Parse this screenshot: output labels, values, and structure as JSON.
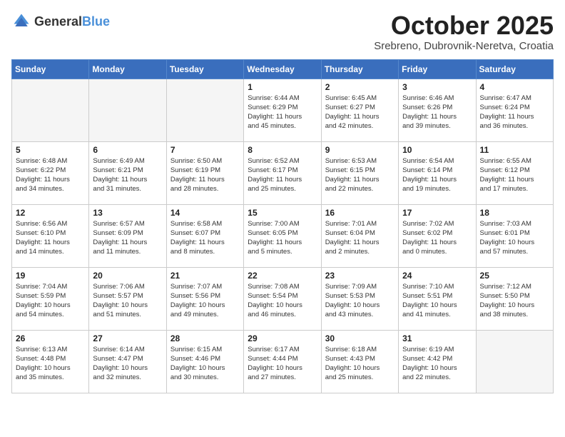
{
  "header": {
    "logo_general": "General",
    "logo_blue": "Blue",
    "month_title": "October 2025",
    "location": "Srebreno, Dubrovnik-Neretva, Croatia"
  },
  "days_of_week": [
    "Sunday",
    "Monday",
    "Tuesday",
    "Wednesday",
    "Thursday",
    "Friday",
    "Saturday"
  ],
  "weeks": [
    [
      {
        "day": "",
        "info": ""
      },
      {
        "day": "",
        "info": ""
      },
      {
        "day": "",
        "info": ""
      },
      {
        "day": "1",
        "info": "Sunrise: 6:44 AM\nSunset: 6:29 PM\nDaylight: 11 hours\nand 45 minutes."
      },
      {
        "day": "2",
        "info": "Sunrise: 6:45 AM\nSunset: 6:27 PM\nDaylight: 11 hours\nand 42 minutes."
      },
      {
        "day": "3",
        "info": "Sunrise: 6:46 AM\nSunset: 6:26 PM\nDaylight: 11 hours\nand 39 minutes."
      },
      {
        "day": "4",
        "info": "Sunrise: 6:47 AM\nSunset: 6:24 PM\nDaylight: 11 hours\nand 36 minutes."
      }
    ],
    [
      {
        "day": "5",
        "info": "Sunrise: 6:48 AM\nSunset: 6:22 PM\nDaylight: 11 hours\nand 34 minutes."
      },
      {
        "day": "6",
        "info": "Sunrise: 6:49 AM\nSunset: 6:21 PM\nDaylight: 11 hours\nand 31 minutes."
      },
      {
        "day": "7",
        "info": "Sunrise: 6:50 AM\nSunset: 6:19 PM\nDaylight: 11 hours\nand 28 minutes."
      },
      {
        "day": "8",
        "info": "Sunrise: 6:52 AM\nSunset: 6:17 PM\nDaylight: 11 hours\nand 25 minutes."
      },
      {
        "day": "9",
        "info": "Sunrise: 6:53 AM\nSunset: 6:15 PM\nDaylight: 11 hours\nand 22 minutes."
      },
      {
        "day": "10",
        "info": "Sunrise: 6:54 AM\nSunset: 6:14 PM\nDaylight: 11 hours\nand 19 minutes."
      },
      {
        "day": "11",
        "info": "Sunrise: 6:55 AM\nSunset: 6:12 PM\nDaylight: 11 hours\nand 17 minutes."
      }
    ],
    [
      {
        "day": "12",
        "info": "Sunrise: 6:56 AM\nSunset: 6:10 PM\nDaylight: 11 hours\nand 14 minutes."
      },
      {
        "day": "13",
        "info": "Sunrise: 6:57 AM\nSunset: 6:09 PM\nDaylight: 11 hours\nand 11 minutes."
      },
      {
        "day": "14",
        "info": "Sunrise: 6:58 AM\nSunset: 6:07 PM\nDaylight: 11 hours\nand 8 minutes."
      },
      {
        "day": "15",
        "info": "Sunrise: 7:00 AM\nSunset: 6:05 PM\nDaylight: 11 hours\nand 5 minutes."
      },
      {
        "day": "16",
        "info": "Sunrise: 7:01 AM\nSunset: 6:04 PM\nDaylight: 11 hours\nand 2 minutes."
      },
      {
        "day": "17",
        "info": "Sunrise: 7:02 AM\nSunset: 6:02 PM\nDaylight: 11 hours\nand 0 minutes."
      },
      {
        "day": "18",
        "info": "Sunrise: 7:03 AM\nSunset: 6:01 PM\nDaylight: 10 hours\nand 57 minutes."
      }
    ],
    [
      {
        "day": "19",
        "info": "Sunrise: 7:04 AM\nSunset: 5:59 PM\nDaylight: 10 hours\nand 54 minutes."
      },
      {
        "day": "20",
        "info": "Sunrise: 7:06 AM\nSunset: 5:57 PM\nDaylight: 10 hours\nand 51 minutes."
      },
      {
        "day": "21",
        "info": "Sunrise: 7:07 AM\nSunset: 5:56 PM\nDaylight: 10 hours\nand 49 minutes."
      },
      {
        "day": "22",
        "info": "Sunrise: 7:08 AM\nSunset: 5:54 PM\nDaylight: 10 hours\nand 46 minutes."
      },
      {
        "day": "23",
        "info": "Sunrise: 7:09 AM\nSunset: 5:53 PM\nDaylight: 10 hours\nand 43 minutes."
      },
      {
        "day": "24",
        "info": "Sunrise: 7:10 AM\nSunset: 5:51 PM\nDaylight: 10 hours\nand 41 minutes."
      },
      {
        "day": "25",
        "info": "Sunrise: 7:12 AM\nSunset: 5:50 PM\nDaylight: 10 hours\nand 38 minutes."
      }
    ],
    [
      {
        "day": "26",
        "info": "Sunrise: 6:13 AM\nSunset: 4:48 PM\nDaylight: 10 hours\nand 35 minutes."
      },
      {
        "day": "27",
        "info": "Sunrise: 6:14 AM\nSunset: 4:47 PM\nDaylight: 10 hours\nand 32 minutes."
      },
      {
        "day": "28",
        "info": "Sunrise: 6:15 AM\nSunset: 4:46 PM\nDaylight: 10 hours\nand 30 minutes."
      },
      {
        "day": "29",
        "info": "Sunrise: 6:17 AM\nSunset: 4:44 PM\nDaylight: 10 hours\nand 27 minutes."
      },
      {
        "day": "30",
        "info": "Sunrise: 6:18 AM\nSunset: 4:43 PM\nDaylight: 10 hours\nand 25 minutes."
      },
      {
        "day": "31",
        "info": "Sunrise: 6:19 AM\nSunset: 4:42 PM\nDaylight: 10 hours\nand 22 minutes."
      },
      {
        "day": "",
        "info": ""
      }
    ]
  ]
}
